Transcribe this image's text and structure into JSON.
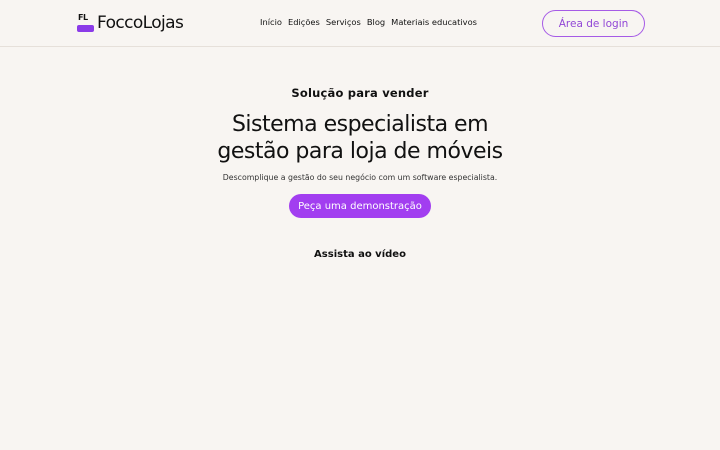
{
  "header": {
    "logo": {
      "mark": "FL",
      "text": "FoccoLojas"
    },
    "nav": [
      "Início",
      "Edições",
      "Serviços",
      "Blog",
      "Materiais educativos"
    ],
    "login_label": "Área de login"
  },
  "hero": {
    "eyebrow": "Solução para vender",
    "title_line1": "Sistema especialista em",
    "title_line2": "gestão para loja de móveis",
    "subtitle": "Descomplique a gestão do seu negócio com um software especialista.",
    "cta_label": "Peça uma demonstração",
    "video_label": "Assista ao vídeo"
  },
  "colors": {
    "accent": "#a23ef0",
    "background": "#f8f5f2",
    "login_border": "#a65be6"
  }
}
